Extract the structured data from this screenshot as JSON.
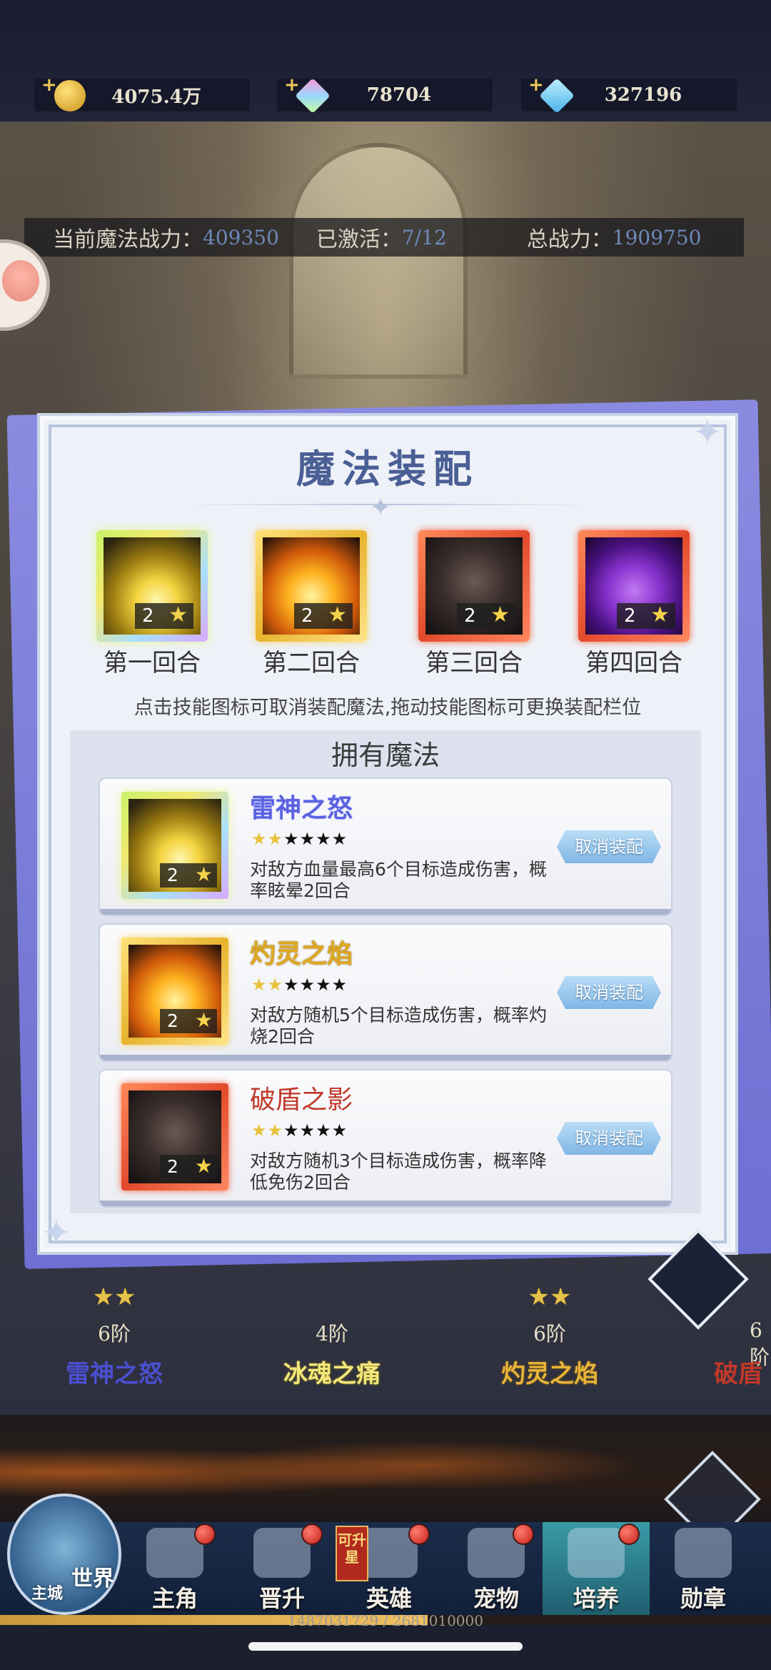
{
  "resources": [
    {
      "icon": "gold-coin-icon",
      "value": "4075.4万"
    },
    {
      "icon": "rainbow-gem-icon",
      "value": "78704"
    },
    {
      "icon": "blue-gem-icon",
      "value": "327196"
    }
  ],
  "info": {
    "magic_power_label": "当前魔法战力：",
    "magic_power_value": "409350",
    "activated_label": "已激活：",
    "activated_value": "7/12",
    "total_power_label": "总战力：",
    "total_power_value": "1909750"
  },
  "modal": {
    "title": "魔法装配",
    "slots": [
      {
        "label": "第一回合",
        "level": "2",
        "art": "thunder",
        "frame": "rainbow"
      },
      {
        "label": "第二回合",
        "level": "2",
        "art": "fire",
        "frame": "gold"
      },
      {
        "label": "第三回合",
        "level": "2",
        "art": "shadow",
        "frame": "red"
      },
      {
        "label": "第四回合",
        "level": "2",
        "art": "purple",
        "frame": "red"
      }
    ],
    "hint": "点击技能图标可取消装配魔法,拖动技能图标可更换装配栏位",
    "owned_title": "拥有魔法",
    "owned": [
      {
        "name": "雷神之怒",
        "name_color": "#5a62e0",
        "stars_on": 2,
        "stars_total": 6,
        "level": "2",
        "desc": "对敌方血量最高6个目标造成伤害，概率眩晕2回合",
        "button": "取消装配",
        "art": "thunder",
        "frame": "rainbow"
      },
      {
        "name": "灼灵之焰",
        "name_color": "#e0a820",
        "stars_on": 2,
        "stars_total": 6,
        "level": "2",
        "desc": "对敌方随机5个目标造成伤害，概率灼烧2回合",
        "button": "取消装配",
        "art": "fire",
        "frame": "gold"
      },
      {
        "name": "破盾之影",
        "name_color": "#c0392b",
        "stars_on": 2,
        "stars_total": 6,
        "level": "2",
        "desc": "对敌方随机3个目标造成伤害，概率降低免伤2回合",
        "button": "取消装配",
        "art": "shadow",
        "frame": "red"
      }
    ]
  },
  "cards": [
    {
      "stars": "★★",
      "tier": "6阶",
      "name": "雷神之怒",
      "color": "#4a4fd0"
    },
    {
      "stars": "",
      "tier": "4阶",
      "name": "冰魂之痛",
      "color": "#f2e77a"
    },
    {
      "stars": "★★",
      "tier": "6阶",
      "name": "灼灵之焰",
      "color": "#e8b43a"
    },
    {
      "stars": "★",
      "tier": "6阶",
      "name": "破盾",
      "color": "#c0392b"
    }
  ],
  "nav": {
    "world_label": "世界",
    "city_label": "主城",
    "items": [
      {
        "label": "主角",
        "badge": true
      },
      {
        "label": "晋升",
        "badge": true
      },
      {
        "label": "英雄",
        "badge": true
      },
      {
        "label": "宠物",
        "badge": true
      },
      {
        "label": "培养",
        "badge": true,
        "active": true
      },
      {
        "label": "勋章",
        "badge": false
      }
    ],
    "upgrade_tag": "可升星"
  },
  "xp": {
    "text": "1487031729 / 2681010000",
    "fraction": 0.5547
  }
}
